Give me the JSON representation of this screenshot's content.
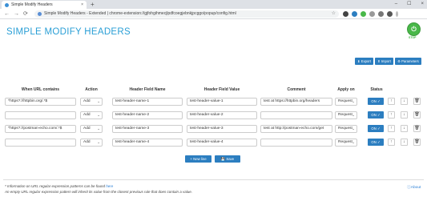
{
  "browser": {
    "tab_title": "Simple Modify Headers",
    "tab_close": "×",
    "new_tab": "+",
    "window_controls": [
      "–",
      "☐",
      "×"
    ],
    "url": "Simple Modify Headers - Extended | chrome-extension://gjfohgihmecjlpdfcoegjebnkjpcggo/popup/config.html",
    "nav": {
      "back": "←",
      "forward": "→",
      "reload": "⟳"
    }
  },
  "page": {
    "title": "SIMPLE MODIFY HEADERS",
    "stop_label": "STOP",
    "stop_icon": "⏻",
    "buttons": {
      "export": "⬇ Export",
      "import": "⬆ Import",
      "parameters": "⚙ Parameters"
    },
    "columns": {
      "url": "When URL contains",
      "action": "Action",
      "header_name": "Header Field Name",
      "header_value": "Header Field Value",
      "comment": "Comment",
      "apply_on": "Apply on",
      "status": "Status"
    },
    "rows": [
      {
        "url": "^https?://httpbin.org/.*$",
        "action": "Add",
        "name": "test-header-name-1",
        "value": "test-header-value-1",
        "comment": "test at https://httpbin.org/headers",
        "apply_on": "Request",
        "status": "ON ✓"
      },
      {
        "url": "",
        "action": "Add",
        "name": "test-header-name-2",
        "value": "test-header-value-2",
        "comment": "",
        "apply_on": "Request",
        "status": "ON ✓"
      },
      {
        "url": "^https?://postman-echo.com/.*$",
        "action": "Add",
        "name": "test-header-name-3",
        "value": "test-header-value-3",
        "comment": "test at http://postman-echo.com/get",
        "apply_on": "Request",
        "status": "ON ✓"
      },
      {
        "url": "",
        "action": "Add",
        "name": "test-header-name-4",
        "value": "test-header-value-4",
        "comment": "",
        "apply_on": "Request",
        "status": "ON ✓"
      }
    ],
    "row_icons": {
      "up": "↑",
      "down": "↓",
      "delete": "🗑",
      "chevron": "⌄"
    },
    "new_line": "+ New line",
    "save": "💾 Save",
    "footer_line1_pre": "* Information on URL regular expression patterns can be found ",
    "footer_link": "here",
    "footer_line2": "An empty URL regular expression pattern will inherit its value from the closest previous rule that does contain a value.",
    "about": "ⓘAbout"
  }
}
